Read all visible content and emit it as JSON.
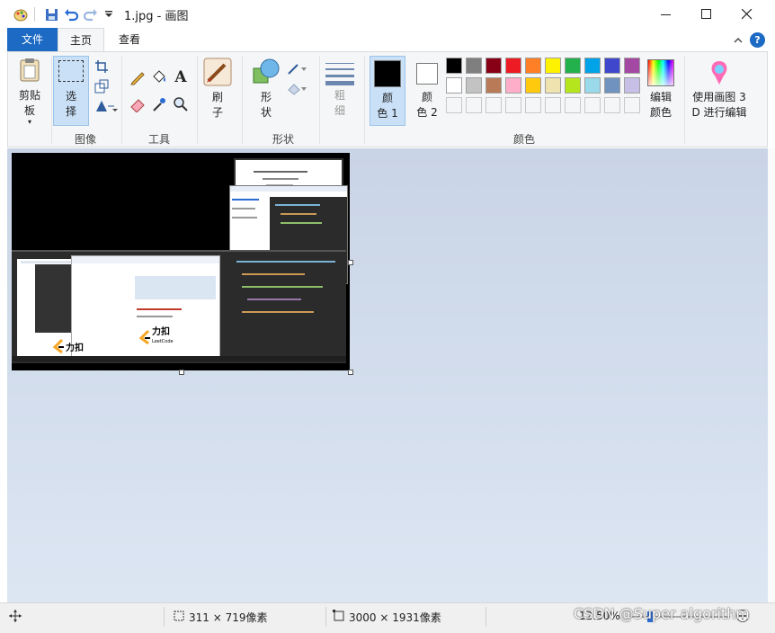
{
  "window": {
    "title": "1.jpg - 画图",
    "minimize_icon": "minimize-icon",
    "maximize_icon": "maximize-icon",
    "close_icon": "close-icon"
  },
  "quick_access": [
    "paint-app-icon",
    "save-icon",
    "undo-icon",
    "redo-icon",
    "customize-dropdown-icon"
  ],
  "tabs": [
    {
      "label": "文件",
      "active": false
    },
    {
      "label": "主页",
      "active": true
    },
    {
      "label": "查看",
      "active": false
    }
  ],
  "ribbon": {
    "collapse_icon": "chevron-up-icon",
    "help_label": "?",
    "clipboard": {
      "label": "剪贴\n板"
    },
    "image_group": {
      "select_label": "选\n择",
      "group_label": "图像"
    },
    "tools_group": {
      "group_label": "工具",
      "text_tool": "A"
    },
    "brush": {
      "label": "刷\n子"
    },
    "shapes": {
      "label": "形\n状",
      "group_label": "形状"
    },
    "size": {
      "label": "粗\n细"
    },
    "color1": {
      "label": "颜\n色 1",
      "value": "#000000"
    },
    "color2": {
      "label": "颜\n色 2",
      "value": "#ffffff"
    },
    "colors_group_label": "颜色",
    "palette": [
      [
        "#000000",
        "#7f7f7f",
        "#880015",
        "#ed1c24",
        "#ff7f27",
        "#fff200",
        "#22b14c",
        "#00a2e8",
        "#3f48cc",
        "#a349a4"
      ],
      [
        "#ffffff",
        "#c3c3c3",
        "#b97a57",
        "#ffaec9",
        "#ffc90e",
        "#efe4b0",
        "#b5e61d",
        "#99d9ea",
        "#7092be",
        "#c8bfe7"
      ],
      [
        "#f5f6f7",
        "#f5f6f7",
        "#f5f6f7",
        "#f5f6f7",
        "#f5f6f7",
        "#f5f6f7",
        "#f5f6f7",
        "#f5f6f7",
        "#f5f6f7",
        "#f5f6f7"
      ]
    ],
    "edit_colors": {
      "label": "编辑\n颜色"
    },
    "paint3d": {
      "label": "使用画图 3\nD 进行编辑"
    }
  },
  "canvas_image": {
    "logo_text": "力扣",
    "logo_sub": "LeetCode"
  },
  "status": {
    "cursor_position": "",
    "selection_size": "311 × 719像素",
    "image_size": "3000 × 1931像素",
    "zoom": "12.50%",
    "watermark": "CSDN @Super algorithm"
  },
  "accent": "#1c6ac4"
}
